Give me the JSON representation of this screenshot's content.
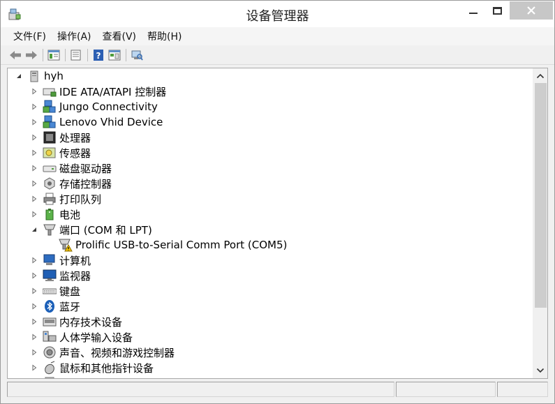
{
  "window": {
    "title": "设备管理器"
  },
  "menubar": {
    "items": [
      "文件(F)",
      "操作(A)",
      "查看(V)",
      "帮助(H)"
    ]
  },
  "toolbar": {
    "buttons": [
      "back-icon",
      "forward-icon",
      "view-icon",
      "properties-icon",
      "help-icon",
      "view-hidden-icon",
      "scan-hardware-icon"
    ]
  },
  "tree": {
    "root": {
      "label": "hyh",
      "expanded": true
    },
    "items": [
      {
        "label": "IDE ATA/ATAPI 控制器",
        "icon": "ide-controller-icon",
        "expanded": false
      },
      {
        "label": "Jungo Connectivity",
        "icon": "network-device-icon",
        "expanded": false
      },
      {
        "label": "Lenovo Vhid Device",
        "icon": "network-device-icon",
        "expanded": false
      },
      {
        "label": "处理器",
        "icon": "processor-icon",
        "expanded": false
      },
      {
        "label": "传感器",
        "icon": "sensor-icon",
        "expanded": false
      },
      {
        "label": "磁盘驱动器",
        "icon": "disk-drive-icon",
        "expanded": false
      },
      {
        "label": "存储控制器",
        "icon": "storage-controller-icon",
        "expanded": false
      },
      {
        "label": "打印队列",
        "icon": "printer-icon",
        "expanded": false
      },
      {
        "label": "电池",
        "icon": "battery-icon",
        "expanded": false
      },
      {
        "label": "端口 (COM 和 LPT)",
        "icon": "port-icon",
        "expanded": true,
        "children": [
          {
            "label": "Prolific USB-to-Serial Comm Port (COM5)",
            "icon": "port-warning-icon",
            "warning": true
          }
        ]
      },
      {
        "label": "计算机",
        "icon": "computer-icon",
        "expanded": false
      },
      {
        "label": "监视器",
        "icon": "monitor-icon",
        "expanded": false
      },
      {
        "label": "键盘",
        "icon": "keyboard-icon",
        "expanded": false
      },
      {
        "label": "蓝牙",
        "icon": "bluetooth-icon",
        "expanded": false
      },
      {
        "label": "内存技术设备",
        "icon": "memory-device-icon",
        "expanded": false
      },
      {
        "label": "人体学输入设备",
        "icon": "hid-icon",
        "expanded": false
      },
      {
        "label": "声音、视频和游戏控制器",
        "icon": "sound-icon",
        "expanded": false
      },
      {
        "label": "鼠标和其他指针设备",
        "icon": "mouse-icon",
        "expanded": false
      }
    ]
  },
  "colors": {
    "close_button": "#c7c7c7",
    "scroll_thumb": "#cdcdcd",
    "warning": "#f5c400",
    "bluetooth": "#1b5fb8"
  }
}
